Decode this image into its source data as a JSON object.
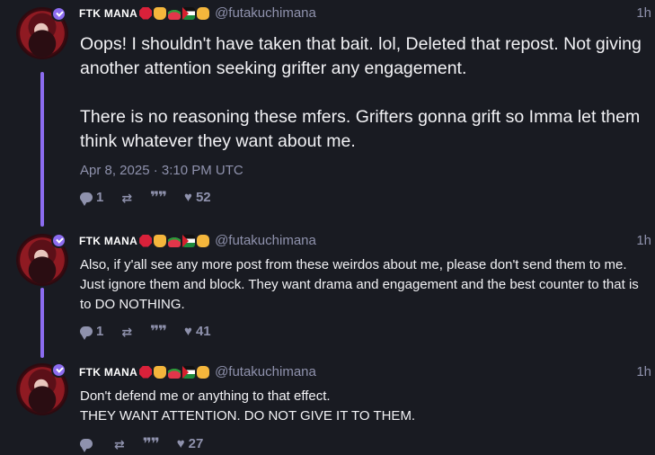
{
  "author": {
    "name": "FTK MANA",
    "handle": "@futakuchimana",
    "emoji_icons": [
      "octagon-red-icon",
      "peace-hand-icon",
      "watermelon-icon",
      "palestine-flag-icon",
      "fist-icon"
    ]
  },
  "colors": {
    "background": "#191b22",
    "thread_line": "#8c6cf0",
    "muted_text": "#8f92ad",
    "body_text": "#f2f2f5"
  },
  "posts": [
    {
      "time": "1h",
      "body": [
        "Oops! I shouldn't have taken that bait. lol, Deleted that repost. Not giving another attention seeking grifter any engagement.",
        "There is no reasoning these mfers. Grifters gonna grift so Imma let them think whatever they want about me."
      ],
      "datetime": "Apr 8, 2025 · 3:10 PM UTC",
      "replies": "1",
      "likes": "52"
    },
    {
      "time": "1h",
      "body": [
        "Also, if y'all see any more post from these weirdos about me, please don't send them to me. Just ignore them and block. They want drama and engagement and the best counter to that is to DO NOTHING."
      ],
      "replies": "1",
      "likes": "41"
    },
    {
      "time": "1h",
      "body": [
        "Don't defend me or anything to that effect.",
        "THEY WANT ATTENTION. DO NOT GIVE IT TO THEM."
      ],
      "replies": "",
      "likes": "27"
    }
  ]
}
